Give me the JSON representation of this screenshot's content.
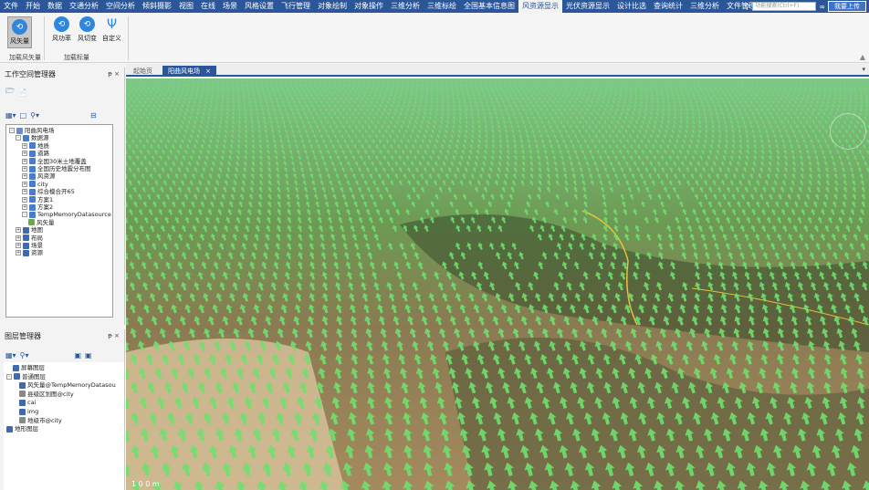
{
  "menubar": {
    "items": [
      "文件",
      "开始",
      "数据",
      "交通分析",
      "空间分析",
      "倾斜摄影",
      "视图",
      "在线",
      "场景",
      "风格设置",
      "飞行管理",
      "对象绘制",
      "对象操作",
      "三维分析",
      "三维标绘",
      "全国基本信息图",
      "风资源显示",
      "光伏资源显示",
      "设计比选",
      "查询统计",
      "三维分析",
      "文件管理"
    ],
    "active_index": 16,
    "search_placeholder": "功能搜索(Ctrl+F)",
    "login": "我要上传"
  },
  "ribbon": {
    "wind_vector": "风矢量",
    "wind_power": "风功率",
    "wind_speed": "风切变",
    "custom": "自定义",
    "group_load_wind": "加载风矢量",
    "group_load_param": "加载标量"
  },
  "workspace": {
    "title": "工作空间管理器",
    "pin": "ᵽ ×",
    "tree": [
      {
        "label": "阳曲风电场",
        "level": 0,
        "exp": "-",
        "icon": "#6b8cc7"
      },
      {
        "label": "数据源",
        "level": 1,
        "exp": "-",
        "icon": "#4a7cc9"
      },
      {
        "label": "地质",
        "level": 2,
        "exp": "+",
        "icon": "#4a7cc9"
      },
      {
        "label": "道路",
        "level": 2,
        "exp": "+",
        "icon": "#4a7cc9"
      },
      {
        "label": "全国30米土地覆盖",
        "level": 2,
        "exp": "+",
        "icon": "#4a7cc9"
      },
      {
        "label": "全国历史地震分布图",
        "level": 2,
        "exp": "+",
        "icon": "#4a7cc9"
      },
      {
        "label": "风资源",
        "level": 2,
        "exp": "+",
        "icon": "#4a7cc9"
      },
      {
        "label": "city",
        "level": 2,
        "exp": "+",
        "icon": "#4a7cc9"
      },
      {
        "label": "综合模合开65",
        "level": 2,
        "exp": "+",
        "icon": "#4a7cc9"
      },
      {
        "label": "方案1",
        "level": 2,
        "exp": "+",
        "icon": "#4a7cc9"
      },
      {
        "label": "方案2",
        "level": 2,
        "exp": "+",
        "icon": "#4a7cc9"
      },
      {
        "label": "TempMemoryDatasource",
        "level": 2,
        "exp": "-",
        "icon": "#4a7cc9"
      },
      {
        "label": "风矢量",
        "level": 3,
        "exp": "",
        "icon": "#6aa84f"
      },
      {
        "label": "地图",
        "level": 1,
        "exp": "+",
        "icon": "#3d6bb3"
      },
      {
        "label": "布局",
        "level": 1,
        "exp": "+",
        "icon": "#3d6bb3"
      },
      {
        "label": "场景",
        "level": 1,
        "exp": "+",
        "icon": "#3d6bb3"
      },
      {
        "label": "资源",
        "level": 1,
        "exp": "+",
        "icon": "#3d6bb3"
      }
    ]
  },
  "layers": {
    "title": "图层管理器",
    "pin": "ᵽ ×",
    "tree": [
      {
        "label": "屏幕图层",
        "level": 1,
        "exp": "",
        "icon": "#3d6bb3"
      },
      {
        "label": "普通图层",
        "level": 0,
        "exp": "-",
        "icon": "#3d6bb3"
      },
      {
        "label": "风矢量@TempMemoryDatasou",
        "level": 2,
        "exp": "",
        "icon": "#3d6bb3"
      },
      {
        "label": "县级区划图@city",
        "level": 2,
        "exp": "",
        "icon": "#888888"
      },
      {
        "label": "cai",
        "level": 2,
        "exp": "",
        "icon": "#3d6bb3"
      },
      {
        "label": "img",
        "level": 2,
        "exp": "",
        "icon": "#3d6bb3"
      },
      {
        "label": "地级市@city",
        "level": 2,
        "exp": "",
        "icon": "#888888"
      },
      {
        "label": "地形图层",
        "level": 0,
        "exp": "",
        "icon": "#3d6bb3"
      }
    ]
  },
  "tabs": [
    {
      "label": "起始页",
      "active": false
    },
    {
      "label": "阳曲风电场",
      "active": true
    }
  ],
  "scene": {
    "arrow_color": "#6fe06f",
    "scale_text": "1 0 0 m"
  }
}
